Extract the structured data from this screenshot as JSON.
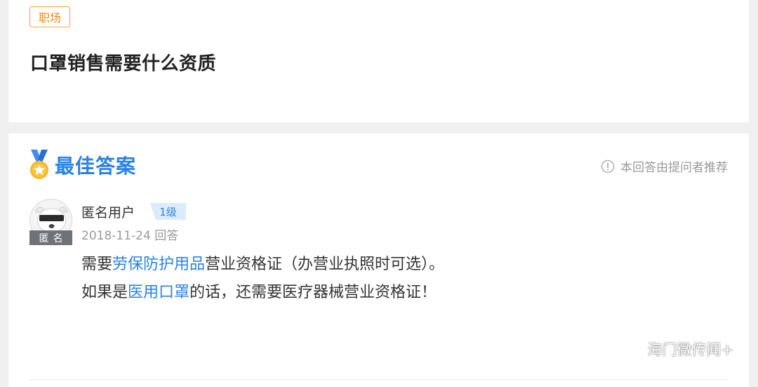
{
  "question": {
    "tag": "职场",
    "title": "口罩销售需要什么资质"
  },
  "best_answer": {
    "header_title": "最佳答案",
    "recommend_note": "本回答由提问者推荐",
    "user": {
      "name": "匿名用户",
      "avatar_badge": "匿名",
      "level": "1级"
    },
    "date": "2018-11-24 回答",
    "line1": {
      "before": "需要",
      "link": "劳保防护用品",
      "after": "营业资格证（办营业执照时可选）。"
    },
    "line2": {
      "before": "如果是",
      "link": "医用口罩",
      "after": "的话，还需要医疗器械营业资格证！"
    }
  },
  "watermark": "海门微传闻+",
  "colors": {
    "accent_blue": "#2a82e4",
    "tag_orange": "#ee8a1a",
    "page_bg": "#f0f0f0"
  },
  "icons": [
    "medal-icon",
    "info-icon",
    "anonymous-avatar-icon",
    "wechat-icon"
  ]
}
